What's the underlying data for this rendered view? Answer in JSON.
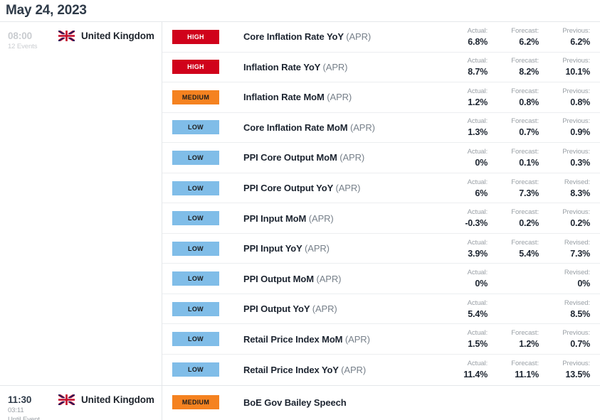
{
  "header": {
    "date_title": "May 24, 2023"
  },
  "columns": {
    "actual": "Actual:",
    "forecast": "Forecast:",
    "previous": "Previous:",
    "revised": "Revised:"
  },
  "groups": [
    {
      "time": "08:00",
      "time_sub1": "12 Events",
      "time_sub2": "",
      "country": "United Kingdom",
      "flag": "uk-flag-icon",
      "events": [
        {
          "impact": "HIGH",
          "impact_level": "high",
          "title": "Core Inflation Rate YoY",
          "period": "(APR)",
          "stats": [
            {
              "label": "Actual:",
              "value": "6.8%"
            },
            {
              "label": "Forecast:",
              "value": "6.2%"
            },
            {
              "label": "Previous:",
              "value": "6.2%"
            }
          ]
        },
        {
          "impact": "HIGH",
          "impact_level": "high",
          "title": "Inflation Rate YoY",
          "period": "(APR)",
          "stats": [
            {
              "label": "Actual:",
              "value": "8.7%"
            },
            {
              "label": "Forecast:",
              "value": "8.2%"
            },
            {
              "label": "Previous:",
              "value": "10.1%"
            }
          ]
        },
        {
          "impact": "MEDIUM",
          "impact_level": "medium",
          "title": "Inflation Rate MoM",
          "period": "(APR)",
          "stats": [
            {
              "label": "Actual:",
              "value": "1.2%"
            },
            {
              "label": "Forecast:",
              "value": "0.8%"
            },
            {
              "label": "Previous:",
              "value": "0.8%"
            }
          ]
        },
        {
          "impact": "LOW",
          "impact_level": "low",
          "title": "Core Inflation Rate MoM",
          "period": "(APR)",
          "stats": [
            {
              "label": "Actual:",
              "value": "1.3%"
            },
            {
              "label": "Forecast:",
              "value": "0.7%"
            },
            {
              "label": "Previous:",
              "value": "0.9%"
            }
          ]
        },
        {
          "impact": "LOW",
          "impact_level": "low",
          "title": "PPI Core Output MoM",
          "period": "(APR)",
          "stats": [
            {
              "label": "Actual:",
              "value": "0%"
            },
            {
              "label": "Forecast:",
              "value": "0.1%"
            },
            {
              "label": "Previous:",
              "value": "0.3%"
            }
          ]
        },
        {
          "impact": "LOW",
          "impact_level": "low",
          "title": "PPI Core Output YoY",
          "period": "(APR)",
          "stats": [
            {
              "label": "Actual:",
              "value": "6%"
            },
            {
              "label": "Forecast:",
              "value": "7.3%"
            },
            {
              "label": "Revised:",
              "value": "8.3%"
            }
          ]
        },
        {
          "impact": "LOW",
          "impact_level": "low",
          "title": "PPI Input MoM",
          "period": "(APR)",
          "stats": [
            {
              "label": "Actual:",
              "value": "-0.3%"
            },
            {
              "label": "Forecast:",
              "value": "0.2%"
            },
            {
              "label": "Previous:",
              "value": "0.2%"
            }
          ]
        },
        {
          "impact": "LOW",
          "impact_level": "low",
          "title": "PPI Input YoY",
          "period": "(APR)",
          "stats": [
            {
              "label": "Actual:",
              "value": "3.9%"
            },
            {
              "label": "Forecast:",
              "value": "5.4%"
            },
            {
              "label": "Revised:",
              "value": "7.3%"
            }
          ]
        },
        {
          "impact": "LOW",
          "impact_level": "low",
          "title": "PPI Output MoM",
          "period": "(APR)",
          "stats": [
            {
              "label": "Actual:",
              "value": "0%"
            },
            {
              "label": "",
              "value": ""
            },
            {
              "label": "Revised:",
              "value": "0%"
            }
          ]
        },
        {
          "impact": "LOW",
          "impact_level": "low",
          "title": "PPI Output YoY",
          "period": "(APR)",
          "stats": [
            {
              "label": "Actual:",
              "value": "5.4%"
            },
            {
              "label": "",
              "value": ""
            },
            {
              "label": "Revised:",
              "value": "8.5%"
            }
          ]
        },
        {
          "impact": "LOW",
          "impact_level": "low",
          "title": "Retail Price Index MoM",
          "period": "(APR)",
          "stats": [
            {
              "label": "Actual:",
              "value": "1.5%"
            },
            {
              "label": "Forecast:",
              "value": "1.2%"
            },
            {
              "label": "Previous:",
              "value": "0.7%"
            }
          ]
        },
        {
          "impact": "LOW",
          "impact_level": "low",
          "title": "Retail Price Index YoY",
          "period": "(APR)",
          "stats": [
            {
              "label": "Actual:",
              "value": "11.4%"
            },
            {
              "label": "Forecast:",
              "value": "11.1%"
            },
            {
              "label": "Previous:",
              "value": "13.5%"
            }
          ]
        }
      ]
    },
    {
      "time": "11:30",
      "time_sub1": "03:11",
      "time_sub2": "Until Event",
      "country": "United Kingdom",
      "flag": "uk-flag-icon",
      "events": [
        {
          "impact": "MEDIUM",
          "impact_level": "medium",
          "title": "BoE Gov Bailey Speech",
          "period": "",
          "stats": []
        }
      ]
    }
  ],
  "colors": {
    "high": "#d0021b",
    "medium": "#f58220",
    "low": "#80bde8",
    "title": "#2f3b49",
    "muted": "#9aa0a6"
  }
}
